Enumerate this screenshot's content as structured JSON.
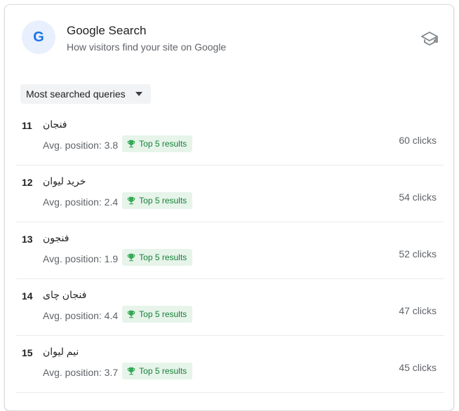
{
  "header": {
    "logo_letter": "G",
    "title": "Google Search",
    "subtitle": "How visitors find your site on Google",
    "learn_icon": "graduation-cap-icon"
  },
  "dropdown": {
    "selected": "Most searched queries"
  },
  "rows": [
    {
      "rank": "11",
      "query": "فنجان",
      "avg_label": "Avg. position: 3.8",
      "badge": "Top 5 results",
      "clicks": "60 clicks"
    },
    {
      "rank": "12",
      "query": "خرید لیوان",
      "avg_label": "Avg. position: 2.4",
      "badge": "Top 5 results",
      "clicks": "54 clicks"
    },
    {
      "rank": "13",
      "query": "فنجون",
      "avg_label": "Avg. position: 1.9",
      "badge": "Top 5 results",
      "clicks": "52 clicks"
    },
    {
      "rank": "14",
      "query": "فنجان چای",
      "avg_label": "Avg. position: 4.4",
      "badge": "Top 5 results",
      "clicks": "47 clicks"
    },
    {
      "rank": "15",
      "query": "نیم لیوان",
      "avg_label": "Avg. position: 3.7",
      "badge": "Top 5 results",
      "clicks": "45 clicks"
    }
  ],
  "colors": {
    "accent": "#1a73e8",
    "badge_bg": "#e6f4ea",
    "badge_text": "#188038"
  }
}
